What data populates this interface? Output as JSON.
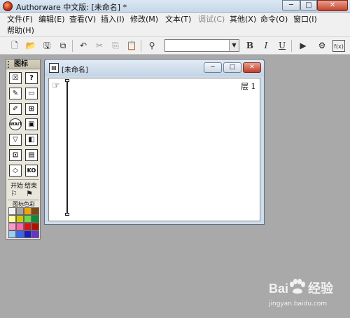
{
  "window": {
    "title": "Authorware 中文版: [未命名] *",
    "controls": {
      "minimize": "─",
      "maximize": "□",
      "close": "✕"
    }
  },
  "menu": [
    {
      "label": "文件(F)",
      "enabled": true
    },
    {
      "label": "编辑(E)",
      "enabled": true
    },
    {
      "label": "查看(V)",
      "enabled": true
    },
    {
      "label": "插入(I)",
      "enabled": true
    },
    {
      "label": "修改(M)",
      "enabled": true
    },
    {
      "label": "文本(T)",
      "enabled": true
    },
    {
      "label": "调试(C)",
      "enabled": false
    },
    {
      "label": "其他(X)",
      "enabled": true
    },
    {
      "label": "命令(O)",
      "enabled": true
    },
    {
      "label": "窗口(I)",
      "enabled": true
    },
    {
      "label": "帮助(H)",
      "enabled": true
    }
  ],
  "toolbar": {
    "new_icon": "new-file-icon",
    "open_icon": "open-folder-icon",
    "save_all_icon": "save-all-icon",
    "import_icon": "import-icon",
    "undo_icon": "undo-icon",
    "cut_icon": "cut-icon",
    "copy_icon": "copy-icon",
    "paste_icon": "paste-icon",
    "find_icon": "find-icon",
    "style_combo_value": "",
    "bold": "B",
    "italic": "I",
    "underline": "U",
    "run_icon": "run-icon",
    "control_panel_icon": "control-panel-icon",
    "functions_icon": "functions-icon"
  },
  "palette": {
    "title": "图标",
    "icons": [
      {
        "name": "display-icon",
        "glyph": "☒"
      },
      {
        "name": "motion-icon",
        "glyph": "?"
      },
      {
        "name": "erase-icon",
        "glyph": "✎"
      },
      {
        "name": "wait-icon",
        "glyph": "▭"
      },
      {
        "name": "navigate-icon",
        "glyph": "✐"
      },
      {
        "name": "framework-icon",
        "glyph": "⊞"
      },
      {
        "name": "decision-icon",
        "glyph": "WAIT"
      },
      {
        "name": "interaction-icon",
        "glyph": "▣"
      },
      {
        "name": "calculation-icon",
        "glyph": "▽"
      },
      {
        "name": "map-icon",
        "glyph": "◧"
      },
      {
        "name": "digital-movie-icon",
        "glyph": "⊡"
      },
      {
        "name": "sound-icon",
        "glyph": "▤"
      },
      {
        "name": "video-icon",
        "glyph": "◇"
      },
      {
        "name": "knowledge-object-icon",
        "glyph": "KO"
      }
    ],
    "start_label": "开始",
    "end_label": "结束",
    "colors_label": "图标色彩",
    "swatches": [
      "#f2f2f2",
      "#a6a6a6",
      "#f0a500",
      "#7a4a12",
      "#ffff99",
      "#c9c900",
      "#66dd44",
      "#118833",
      "#ff99cc",
      "#ff66aa",
      "#dd1111",
      "#aa1100",
      "#99ccff",
      "#3366ff",
      "#1a1acc",
      "#6633cc"
    ]
  },
  "document": {
    "title": "[未命名]",
    "controls": {
      "minimize": "─",
      "maximize": "□",
      "close": "✕"
    },
    "layer_label": "层 1"
  },
  "watermark": {
    "logo_left": "Bai",
    "logo_right": "经验",
    "url": "jingyan.baidu.com"
  }
}
